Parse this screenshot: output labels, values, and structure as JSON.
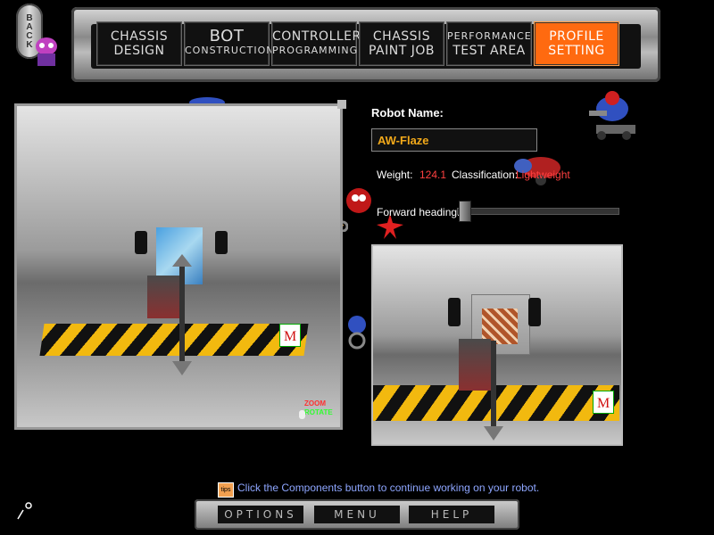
{
  "nav": {
    "back_label": "BACK",
    "tabs": [
      {
        "line1": "CHASSIS",
        "line2": "DESIGN"
      },
      {
        "line1": "BOT",
        "line2": "CONSTRUCTION"
      },
      {
        "line1": "CONTROLLER",
        "line2": "PROGRAMMING"
      },
      {
        "line1": "CHASSIS",
        "line2": "PAINT JOB"
      },
      {
        "line1": "PERFORMANCE",
        "line2": "TEST AREA"
      },
      {
        "line1": "PROFILE",
        "line2": "SETTING"
      }
    ],
    "active_tab": "PROFILE SETTING"
  },
  "profile": {
    "robot_name_label": "Robot Name:",
    "robot_name_value": "AW-Flaze",
    "weight_label": "Weight:",
    "weight_value": "124.1",
    "classification_label": "Classification:",
    "classification_value": "Lightweight",
    "heading_label": "Forward heading:",
    "heading_value": 0
  },
  "viewport": {
    "zoom_label": "ZOOM",
    "rotate_label": "ROTATE",
    "zoom_color": "#ff3030",
    "rotate_color": "#30ff30"
  },
  "tip": {
    "icon_text": "tips",
    "text": "Click the Components button to continue working on your robot."
  },
  "bottom": {
    "options_label": "OPTIONS",
    "menu_label": "MENU",
    "help_label": "HELP"
  },
  "colors": {
    "accent": "#ff6a10",
    "name_text": "#f2a91a",
    "weight_text": "#ff4040",
    "tip_text": "#8ea6ff"
  }
}
